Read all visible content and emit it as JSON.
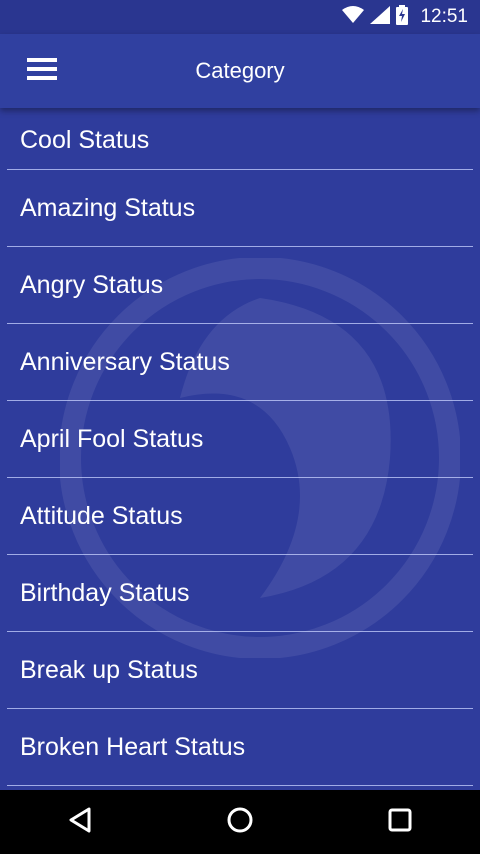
{
  "status_bar": {
    "time": "12:51",
    "icons": [
      "wifi-icon",
      "signal-icon",
      "battery-charging-icon"
    ]
  },
  "app_bar": {
    "menu_icon": "hamburger-menu-icon",
    "title": "Category"
  },
  "categories": [
    "Cool Status",
    "Amazing Status",
    "Angry Status",
    "Anniversary Status",
    "April Fool Status",
    "Attitude Status",
    "Birthday Status",
    "Break up Status",
    "Broken Heart Status"
  ],
  "nav_bar": {
    "icons": [
      "back-icon",
      "home-icon",
      "recents-icon"
    ]
  },
  "colors": {
    "background": "#2f3c9c",
    "app_bar": "#3040a0",
    "status_bar": "#2a3690",
    "text": "#ffffff",
    "divider": "#c8d2ff",
    "nav_bar": "#000000"
  }
}
